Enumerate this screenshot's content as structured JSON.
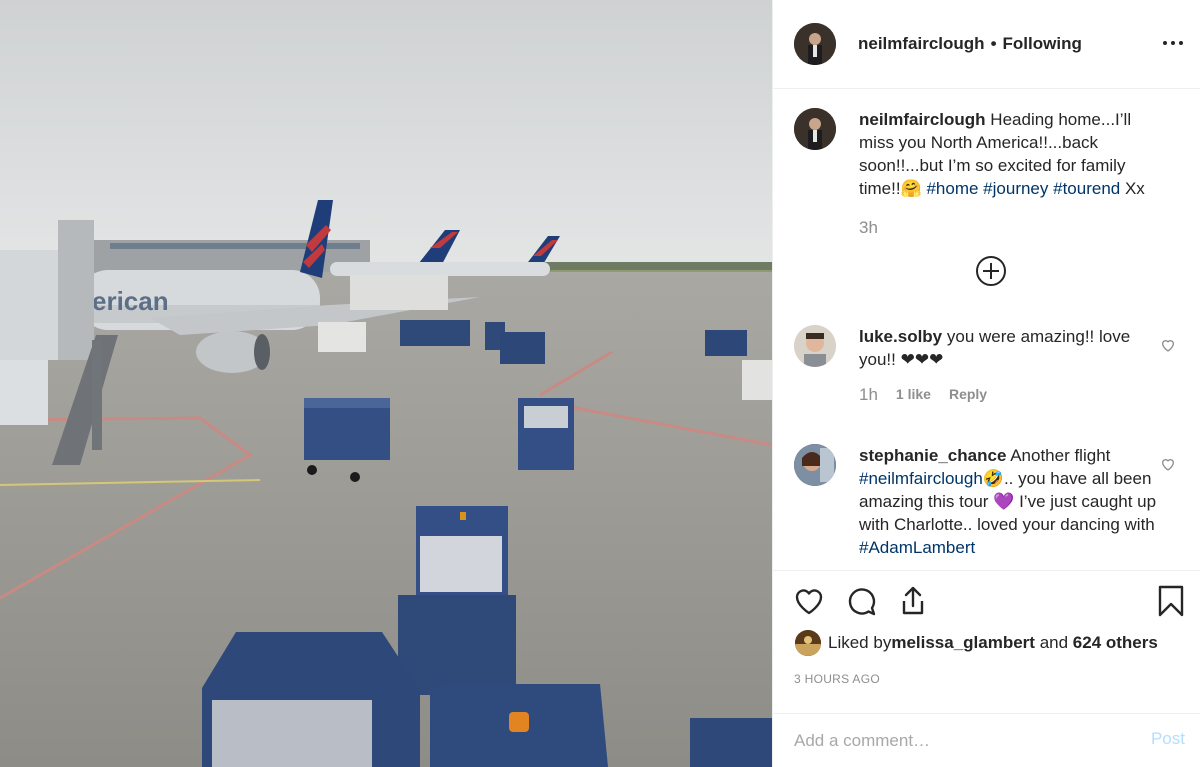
{
  "post": {
    "author": "neilmfairclough",
    "follow_status": "Following",
    "separator": "•"
  },
  "caption": {
    "username": "neilmfairclough",
    "text_1": " Heading home...I’ll miss you North America!!...back soon!!...but I’m so excited for family time!!🤗 ",
    "tag_1": "#home",
    "tag_2": "#journey",
    "tag_3": "#tourend",
    "text_2": " Xx",
    "time": "3h"
  },
  "comments": [
    {
      "username": "luke.solby",
      "text": " you were amazing!! love you!! ❤❤❤",
      "time": "1h",
      "likes": "1 like",
      "reply": "Reply"
    },
    {
      "username": "stephanie_chance",
      "text_1": " Another flight ",
      "tag_1": "#neilmfairclough",
      "text_2": "🤣.. you have all been amazing this tour 💜 I’ve just caught up with Charlotte.. loved your dancing with ",
      "tag_2": "#AdamLambert"
    }
  ],
  "actions": {
    "liked_by_prefix": "Liked by ",
    "liked_by_user": "melissa_glambert",
    "and": " and ",
    "others": "624 others",
    "timestamp": "3 HOURS AGO"
  },
  "comment_box": {
    "placeholder": "Add a comment…",
    "post_label": "Post"
  },
  "icons": [
    "more-options-icon",
    "load-more-icon",
    "heart-icon",
    "comment-icon",
    "share-icon",
    "bookmark-icon"
  ],
  "colors": {
    "link": "#003569",
    "muted": "#8e8e8e",
    "post_disabled": "#b2dffc"
  }
}
